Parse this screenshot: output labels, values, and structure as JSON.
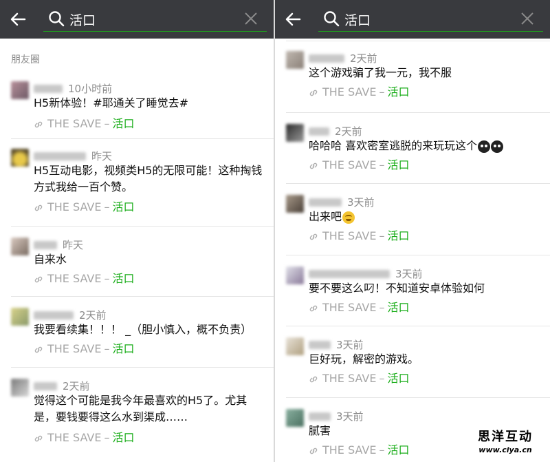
{
  "colors": {
    "topbar": "#393a3e",
    "accent_green": "#1aad19",
    "muted": "#a6a6a6"
  },
  "search": {
    "query": "活口"
  },
  "left": {
    "section_label": "朋友圈",
    "posts": [
      {
        "time": "10小时前",
        "text": "H5新体验！#耶通关了睡觉去#",
        "link_site": "THE SAVE",
        "link_name": "活口"
      },
      {
        "time": "昨天",
        "text": "H5互动电影，视频类H5的无限可能！这种掏钱方式我给一百个赞。",
        "link_site": "THE SAVE",
        "link_name": "活口"
      },
      {
        "time": "昨天",
        "text": "自来水",
        "link_site": "THE SAVE",
        "link_name": "活口"
      },
      {
        "time": "2天前",
        "text": "我要看续集！！！ _（胆小慎入，概不负责）",
        "link_site": "THE SAVE",
        "link_name": "活口"
      },
      {
        "time": "2天前",
        "text": "觉得这个可能是我今年最喜欢的H5了。尤其是，要钱要得这么水到渠成……",
        "link_site": "THE SAVE",
        "link_name": "活口"
      }
    ]
  },
  "right": {
    "posts": [
      {
        "time": "2天前",
        "text": "这个游戏骗了我一元，我不服",
        "link_site": "THE SAVE",
        "link_name": "活口"
      },
      {
        "time": "2天前",
        "text": "哈哈哈 喜欢密室逃脱的来玩玩这个",
        "emoji": "dark-face-icon",
        "link_site": "THE SAVE",
        "link_name": "活口"
      },
      {
        "time": "3天前",
        "text": "出来吧",
        "emoji": "grin-face-icon",
        "link_site": "THE SAVE",
        "link_name": "活口"
      },
      {
        "time": "3天前",
        "text": "要不要这么叼！不知道安卓体验如何",
        "link_site": "THE SAVE",
        "link_name": "活口"
      },
      {
        "time": "3天前",
        "text": "巨好玩，解密的游戏。",
        "link_site": "THE SAVE",
        "link_name": "活口"
      },
      {
        "time": "3天前",
        "text": "腻害",
        "link_site": "THE SAVE",
        "link_name": "活口"
      }
    ]
  },
  "watermark": {
    "brand": "思洋互动",
    "url": "www.ciya.cn"
  }
}
